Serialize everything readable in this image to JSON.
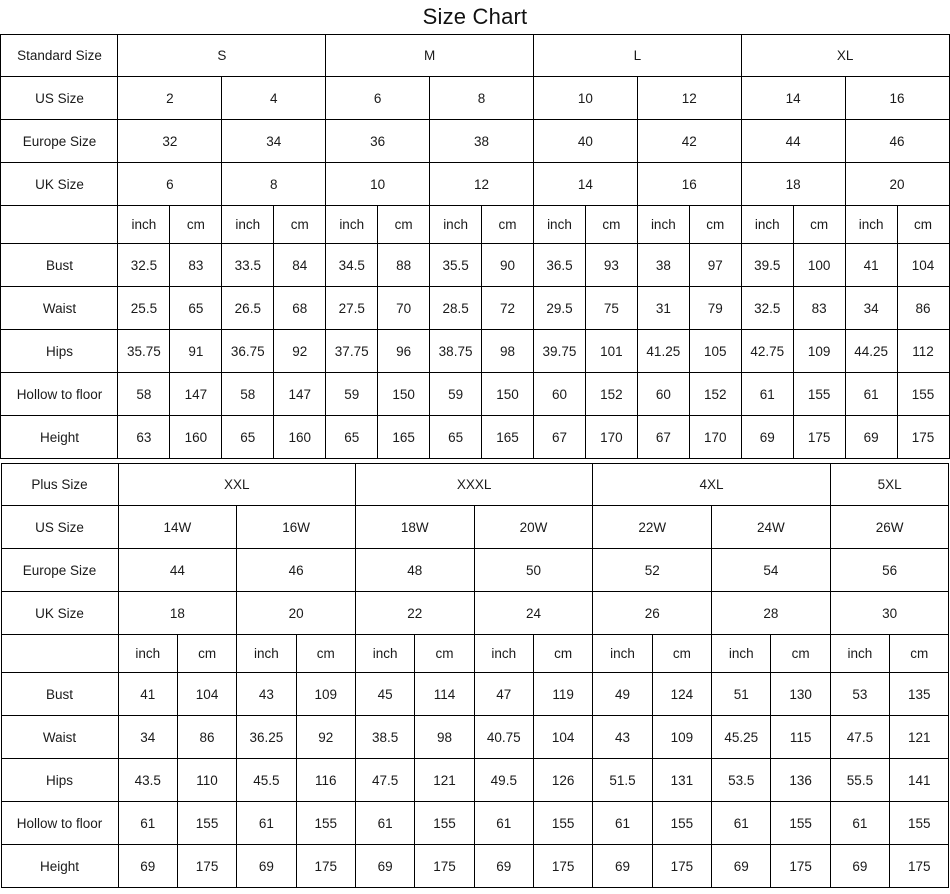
{
  "title": "Size Chart",
  "tables": [
    {
      "id": "standard",
      "label_header": "Standard Size",
      "group_labels": [
        "S",
        "M",
        "L",
        "XL"
      ],
      "group_spans": [
        2,
        2,
        2,
        2
      ],
      "rows": [
        {
          "label": "US Size",
          "values": [
            "2",
            "4",
            "6",
            "8",
            "10",
            "12",
            "14",
            "16"
          ]
        },
        {
          "label": "Europe Size",
          "values": [
            "32",
            "34",
            "36",
            "38",
            "40",
            "42",
            "44",
            "46"
          ]
        },
        {
          "label": "UK Size",
          "values": [
            "6",
            "8",
            "10",
            "12",
            "14",
            "16",
            "18",
            "20"
          ]
        }
      ],
      "unit_row": {
        "label": "",
        "units": [
          "inch",
          "cm",
          "inch",
          "cm",
          "inch",
          "cm",
          "inch",
          "cm",
          "inch",
          "cm",
          "inch",
          "cm",
          "inch",
          "cm",
          "inch",
          "cm"
        ]
      },
      "measurements": [
        {
          "label": "Bust",
          "values": [
            "32.5",
            "83",
            "33.5",
            "84",
            "34.5",
            "88",
            "35.5",
            "90",
            "36.5",
            "93",
            "38",
            "97",
            "39.5",
            "100",
            "41",
            "104"
          ]
        },
        {
          "label": "Waist",
          "values": [
            "25.5",
            "65",
            "26.5",
            "68",
            "27.5",
            "70",
            "28.5",
            "72",
            "29.5",
            "75",
            "31",
            "79",
            "32.5",
            "83",
            "34",
            "86"
          ]
        },
        {
          "label": "Hips",
          "values": [
            "35.75",
            "91",
            "36.75",
            "92",
            "37.75",
            "96",
            "38.75",
            "98",
            "39.75",
            "101",
            "41.25",
            "105",
            "42.75",
            "109",
            "44.25",
            "112"
          ]
        },
        {
          "label": "Hollow to floor",
          "values": [
            "58",
            "147",
            "58",
            "147",
            "59",
            "150",
            "59",
            "150",
            "60",
            "152",
            "60",
            "152",
            "61",
            "155",
            "61",
            "155"
          ]
        },
        {
          "label": "Height",
          "values": [
            "63",
            "160",
            "65",
            "160",
            "65",
            "165",
            "65",
            "165",
            "67",
            "170",
            "67",
            "170",
            "69",
            "175",
            "69",
            "175"
          ]
        }
      ]
    },
    {
      "id": "plus",
      "label_header": "Plus Size",
      "group_labels": [
        "XXL",
        "XXXL",
        "4XL",
        "5XL"
      ],
      "group_spans": [
        2,
        2,
        2,
        1
      ],
      "rows": [
        {
          "label": "US Size",
          "values": [
            "14W",
            "16W",
            "18W",
            "20W",
            "22W",
            "24W",
            "26W"
          ]
        },
        {
          "label": "Europe Size",
          "values": [
            "44",
            "46",
            "48",
            "50",
            "52",
            "54",
            "56"
          ]
        },
        {
          "label": "UK Size",
          "values": [
            "18",
            "20",
            "22",
            "24",
            "26",
            "28",
            "30"
          ]
        }
      ],
      "unit_row": {
        "label": "",
        "units": [
          "inch",
          "cm",
          "inch",
          "cm",
          "inch",
          "cm",
          "inch",
          "cm",
          "inch",
          "cm",
          "inch",
          "cm",
          "inch",
          "cm"
        ]
      },
      "measurements": [
        {
          "label": "Bust",
          "values": [
            "41",
            "104",
            "43",
            "109",
            "45",
            "114",
            "47",
            "119",
            "49",
            "124",
            "51",
            "130",
            "53",
            "135"
          ]
        },
        {
          "label": "Waist",
          "values": [
            "34",
            "86",
            "36.25",
            "92",
            "38.5",
            "98",
            "40.75",
            "104",
            "43",
            "109",
            "45.25",
            "115",
            "47.5",
            "121"
          ]
        },
        {
          "label": "Hips",
          "values": [
            "43.5",
            "110",
            "45.5",
            "116",
            "47.5",
            "121",
            "49.5",
            "126",
            "51.5",
            "131",
            "53.5",
            "136",
            "55.5",
            "141"
          ]
        },
        {
          "label": "Hollow to floor",
          "values": [
            "61",
            "155",
            "61",
            "155",
            "61",
            "155",
            "61",
            "155",
            "61",
            "155",
            "61",
            "155",
            "61",
            "155"
          ]
        },
        {
          "label": "Height",
          "values": [
            "69",
            "175",
            "69",
            "175",
            "69",
            "175",
            "69",
            "175",
            "69",
            "175",
            "69",
            "175",
            "69",
            "175"
          ]
        }
      ]
    }
  ],
  "colors": {
    "shade": "#cccccc",
    "border": "#000000",
    "text": "#1a1a1a",
    "background": "#ffffff"
  }
}
